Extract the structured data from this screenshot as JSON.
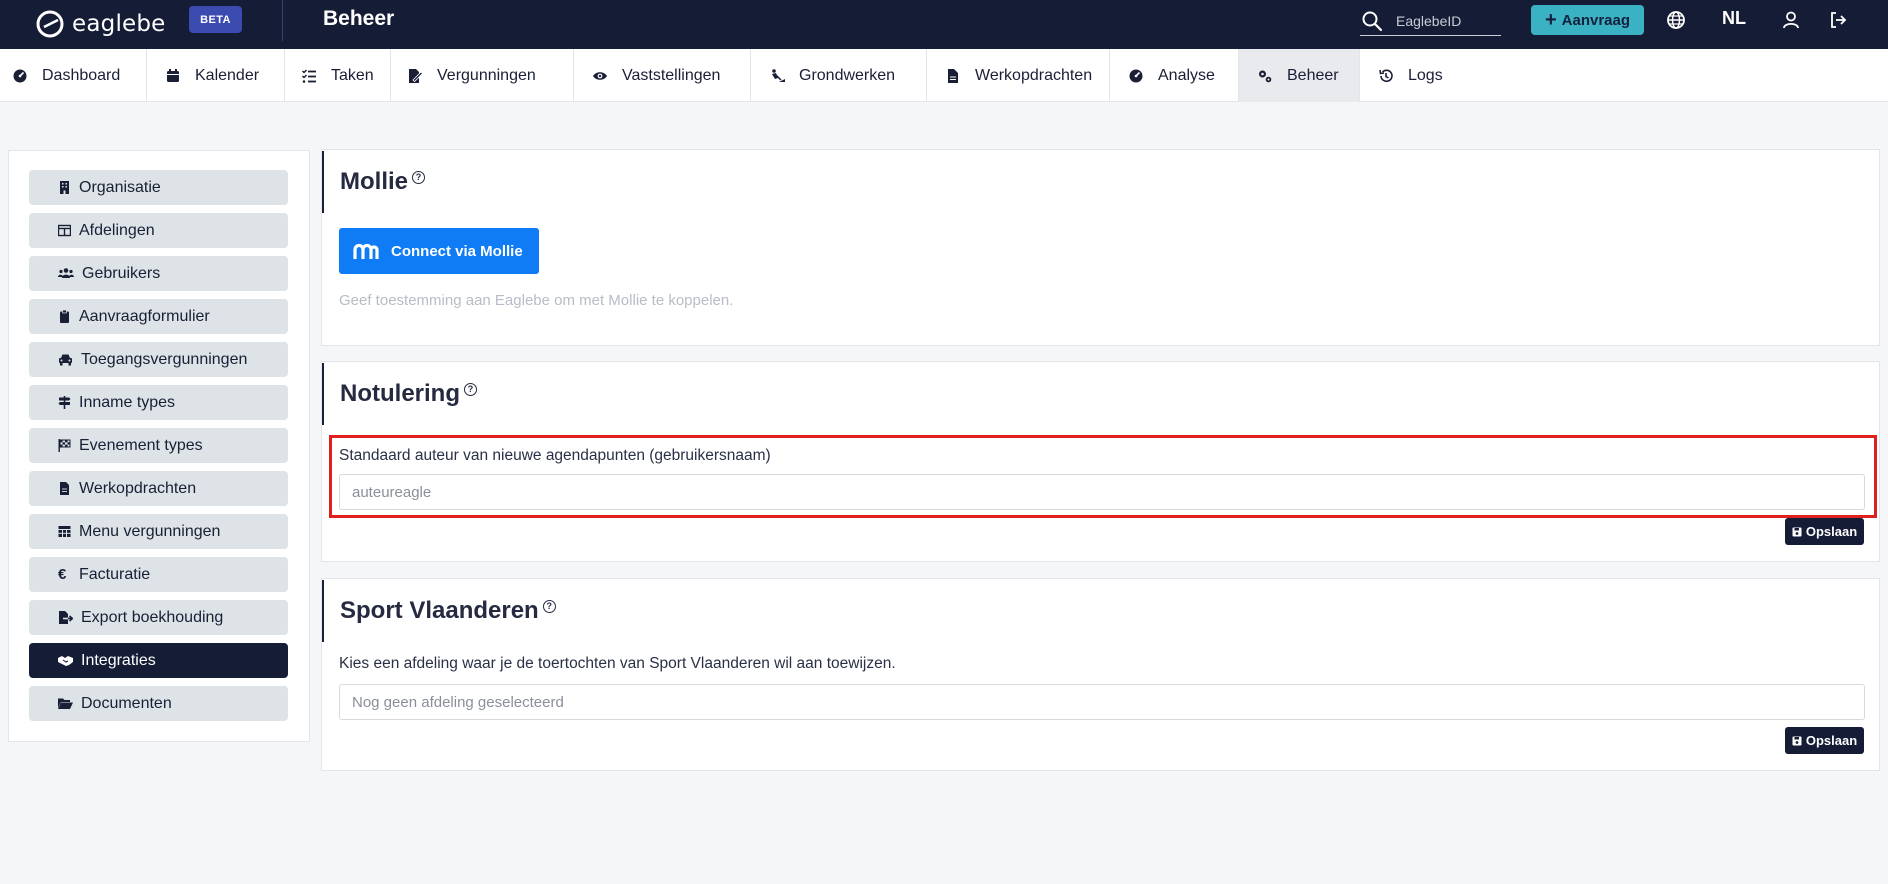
{
  "topbar": {
    "brand": "eaglebe",
    "beta": "BETA",
    "page_title": "Beheer",
    "search_placeholder": "EaglebeID",
    "new_request": "Aanvraag",
    "language": "NL"
  },
  "nav": [
    {
      "label": "Dashboard",
      "icon": "gauge-icon"
    },
    {
      "label": "Kalender",
      "icon": "calendar-icon"
    },
    {
      "label": "Taken",
      "icon": "tasks-icon"
    },
    {
      "label": "Vergunningen",
      "icon": "file-signature-icon"
    },
    {
      "label": "Vaststellingen",
      "icon": "eye-icon"
    },
    {
      "label": "Grondwerken",
      "icon": "digging-icon"
    },
    {
      "label": "Werkopdrachten",
      "icon": "file-icon"
    },
    {
      "label": "Analyse",
      "icon": "gauge-icon"
    },
    {
      "label": "Beheer",
      "icon": "cogs-icon"
    },
    {
      "label": "Logs",
      "icon": "history-icon"
    }
  ],
  "sidebar": [
    {
      "label": "Organisatie",
      "icon": "building-icon"
    },
    {
      "label": "Afdelingen",
      "icon": "table-icon"
    },
    {
      "label": "Gebruikers",
      "icon": "users-icon"
    },
    {
      "label": "Aanvraagformulier",
      "icon": "clipboard-icon"
    },
    {
      "label": "Toegangsvergunningen",
      "icon": "car-icon"
    },
    {
      "label": "Inname types",
      "icon": "signs-icon"
    },
    {
      "label": "Evenement types",
      "icon": "flag-checkered-icon"
    },
    {
      "label": "Werkopdrachten",
      "icon": "file-icon"
    },
    {
      "label": "Menu vergunningen",
      "icon": "grid-icon"
    },
    {
      "label": "Facturatie",
      "icon": "euro-icon"
    },
    {
      "label": "Export boekhouding",
      "icon": "file-export-icon"
    },
    {
      "label": "Integraties",
      "icon": "handshake-icon"
    },
    {
      "label": "Documenten",
      "icon": "folder-open-icon"
    }
  ],
  "mollie": {
    "title": "Mollie",
    "help": "?",
    "connect_button": "Connect via Mollie",
    "hint": "Geef toestemming aan Eaglebe om met Mollie te koppelen."
  },
  "notulering": {
    "title": "Notulering",
    "help": "?",
    "field_label": "Standaard auteur van nieuwe agendapunten (gebruikersnaam)",
    "field_value": "auteureagle",
    "save": "Opslaan"
  },
  "sport": {
    "title": "Sport Vlaanderen",
    "help": "?",
    "description": "Kies een afdeling waar je de toertochten van Sport Vlaanderen wil aan toewijzen.",
    "select_placeholder": "Nog geen afdeling geselecteerd",
    "save": "Opslaan"
  },
  "colors": {
    "topbar": "#151c35",
    "accent": "#3bb2c4",
    "mollie_blue": "#0f7cf5",
    "highlight": "#e0201e"
  }
}
